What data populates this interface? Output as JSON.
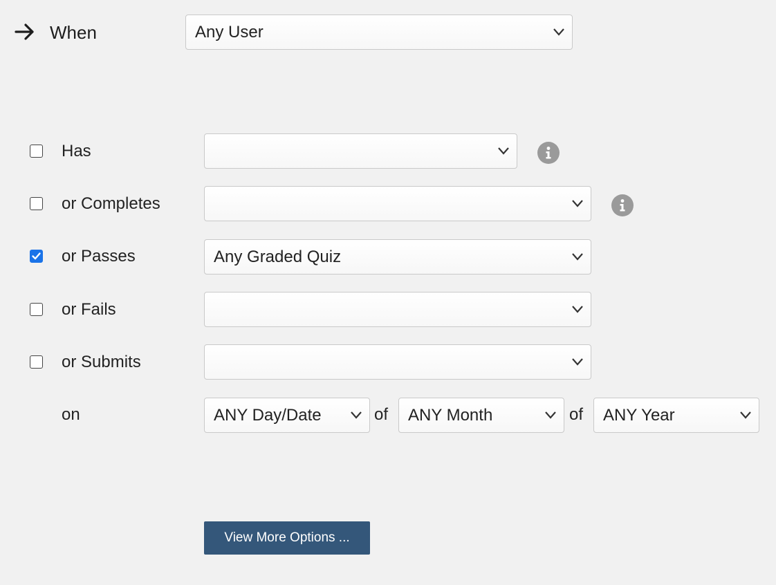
{
  "header": {
    "label": "When",
    "user_select": "Any User"
  },
  "conditions": [
    {
      "label": "Has",
      "value": "",
      "checked": false
    },
    {
      "label": "or Completes",
      "value": "",
      "checked": false
    },
    {
      "label": "or Passes",
      "value": "Any Graded Quiz",
      "checked": true
    },
    {
      "label": "or Fails",
      "value": "",
      "checked": false
    },
    {
      "label": "or Submits",
      "value": "",
      "checked": false
    }
  ],
  "date": {
    "label": "on",
    "day": "ANY Day/Date",
    "of1": "of",
    "month": "ANY Month",
    "of2": "of",
    "year": "ANY Year"
  },
  "button": {
    "label": "View More Options ..."
  },
  "colors": {
    "button_bg": "#34577a",
    "checkbox_checked": "#1a73e8",
    "info_icon": "#9a9a9a"
  }
}
